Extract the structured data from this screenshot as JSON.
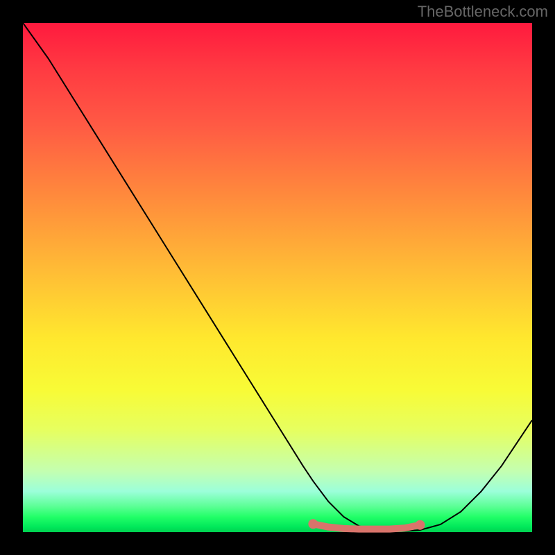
{
  "attribution": "TheBottleneck.com",
  "chart_data": {
    "type": "line",
    "title": "",
    "xlabel": "",
    "ylabel": "",
    "xlim": [
      0,
      100
    ],
    "ylim": [
      0,
      100
    ],
    "grid": false,
    "series": [
      {
        "name": "bottleneck-curve",
        "x": [
          0,
          5,
          10,
          15,
          20,
          25,
          30,
          35,
          40,
          45,
          50,
          55,
          57,
          60,
          63,
          66,
          69,
          72,
          75,
          78,
          82,
          86,
          90,
          94,
          98,
          100
        ],
        "y": [
          100,
          93,
          85,
          77,
          69,
          61,
          53,
          45,
          37,
          29,
          21,
          13,
          10,
          6,
          3,
          1.2,
          0.4,
          0.2,
          0.2,
          0.4,
          1.5,
          4,
          8,
          13,
          19,
          22
        ],
        "color": "#000000",
        "width": 2
      },
      {
        "name": "optimal-band",
        "x": [
          57,
          60,
          63,
          66,
          69,
          72,
          75,
          78
        ],
        "y": [
          1.6,
          1.0,
          0.7,
          0.6,
          0.6,
          0.6,
          0.8,
          1.4
        ],
        "color": "#d9746b",
        "width": 10,
        "endpoints": true
      }
    ],
    "gradient_stops": [
      {
        "pos": 0,
        "color": "#ff1a3e"
      },
      {
        "pos": 50,
        "color": "#ffd030"
      },
      {
        "pos": 80,
        "color": "#e0ff70"
      },
      {
        "pos": 100,
        "color": "#00d050"
      }
    ]
  }
}
